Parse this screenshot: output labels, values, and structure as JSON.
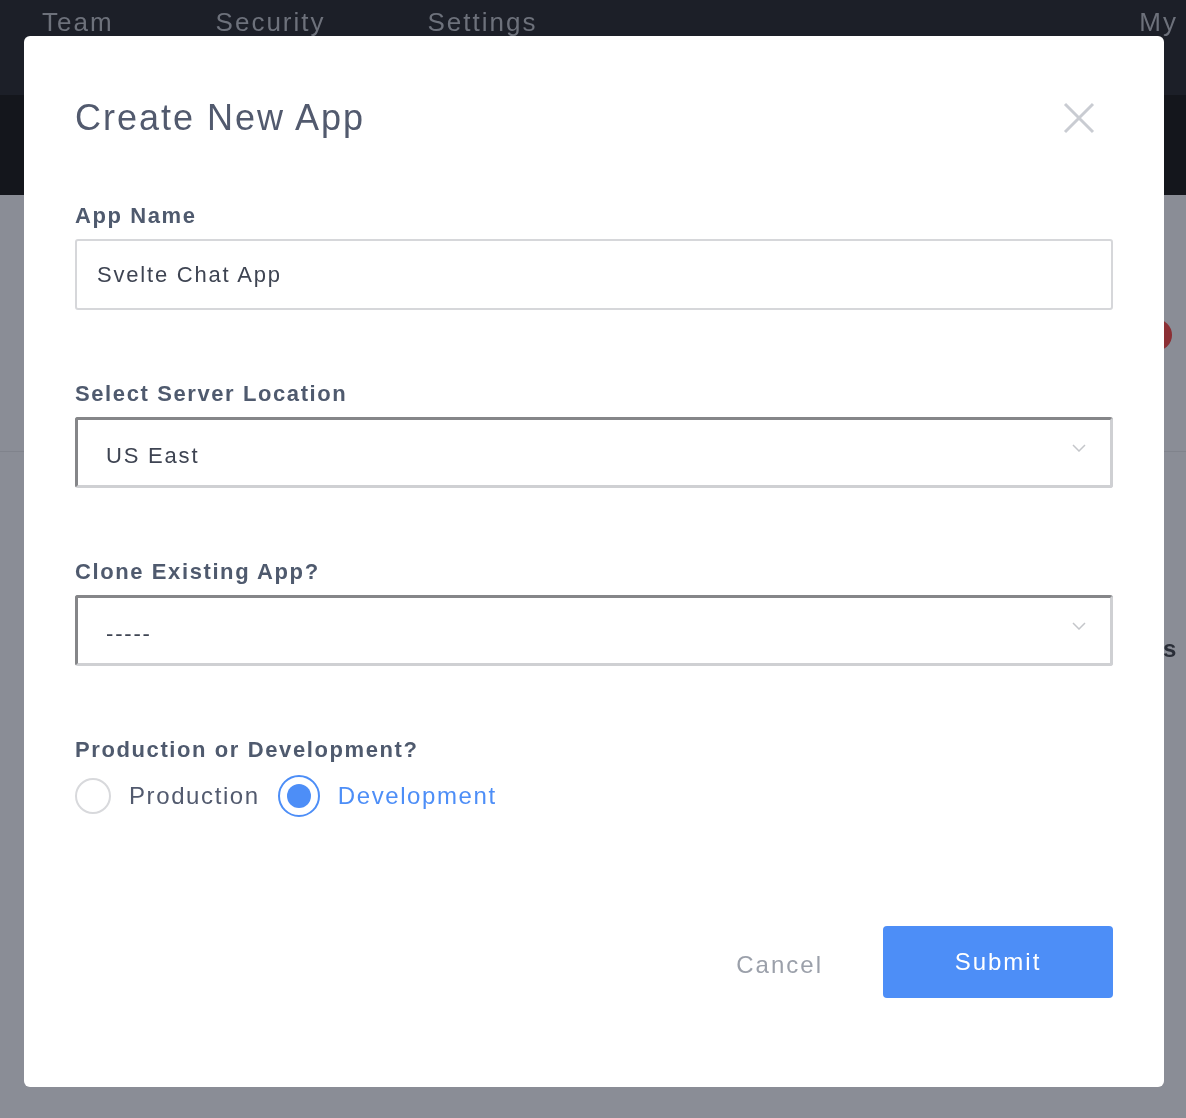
{
  "nav": {
    "items": [
      "Team",
      "Security",
      "Settings"
    ],
    "account": "My"
  },
  "background": {
    "fragment": "s"
  },
  "dialog": {
    "title": "Create New App",
    "fields": [
      {
        "kind": "text",
        "label": "App Name",
        "value": "Svelte Chat App"
      },
      {
        "kind": "select",
        "label": "Select Server Location",
        "value": "US East"
      },
      {
        "kind": "select",
        "label": "Clone Existing App?",
        "value": "-----"
      }
    ],
    "environment": {
      "label": "Production or Development?",
      "options": [
        {
          "label": "Production",
          "selected": false
        },
        {
          "label": "Development",
          "selected": true
        }
      ]
    },
    "buttons": [
      {
        "kind": "secondary",
        "label": "Cancel"
      },
      {
        "kind": "primary",
        "label": "Submit"
      }
    ]
  }
}
